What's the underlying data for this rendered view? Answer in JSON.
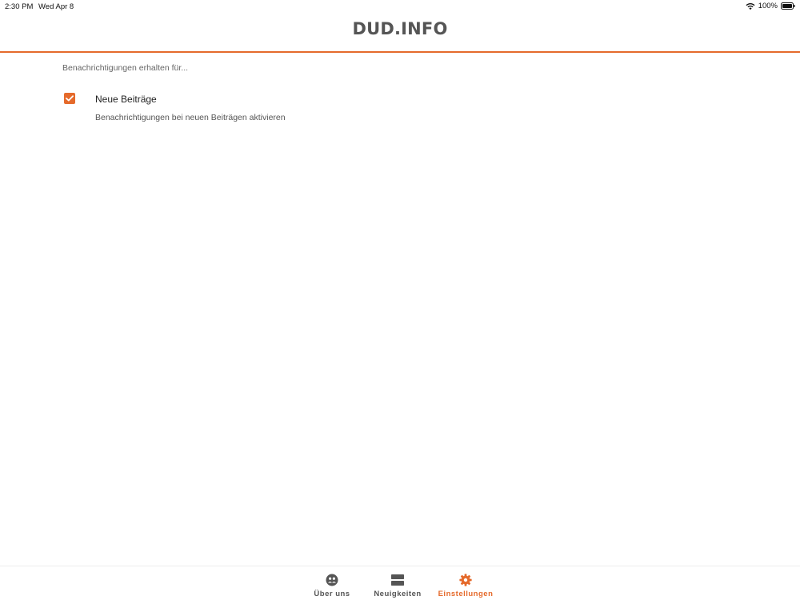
{
  "status_bar": {
    "time": "2:30 PM",
    "date": "Wed Apr 8",
    "battery": "100%",
    "icons": [
      "wifi-icon",
      "battery-icon"
    ]
  },
  "header": {
    "title": "DUD.INFO"
  },
  "settings": {
    "caption": "Benachrichtigungen erhalten für...",
    "items": [
      {
        "title": "Neue Beiträge",
        "description": "Benachrichtigungen bei neuen Beiträgen aktivieren",
        "checked": true,
        "icon": "check-icon"
      }
    ]
  },
  "tab_bar": {
    "tabs": [
      {
        "label": "Über uns",
        "icon": "people-icon",
        "active": false
      },
      {
        "label": "Neuigkeiten",
        "icon": "news-icon",
        "active": false
      },
      {
        "label": "Einstellungen",
        "icon": "gear-icon",
        "active": true
      }
    ]
  },
  "colors": {
    "accent": "#e56a2b",
    "title_text": "#555555",
    "inactive_tab": "#555555"
  }
}
